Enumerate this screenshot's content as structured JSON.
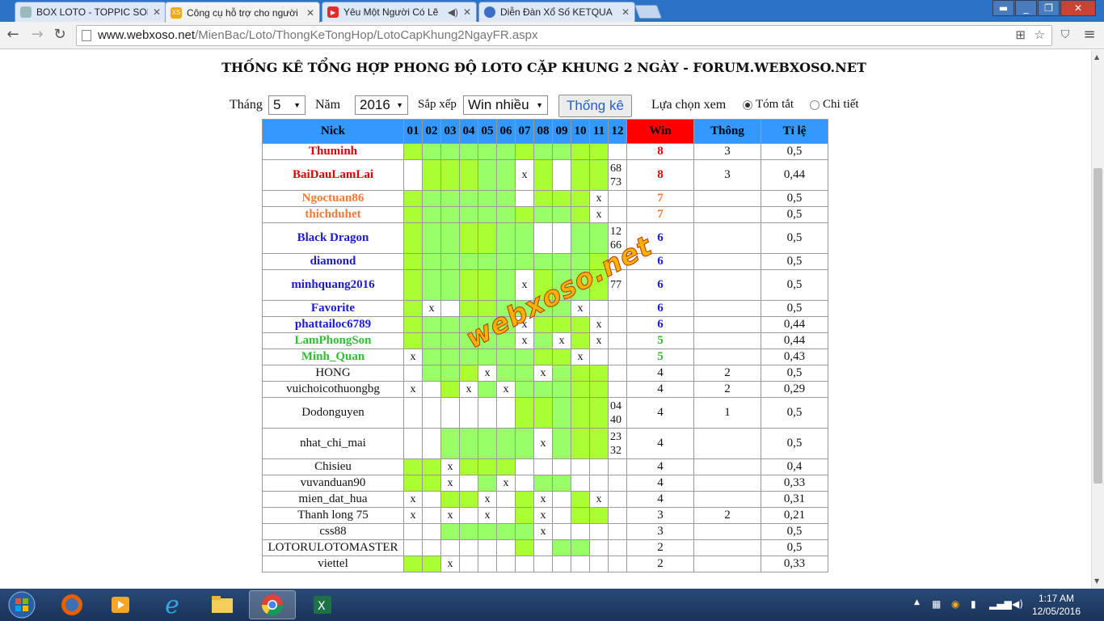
{
  "browser": {
    "tabs": [
      {
        "title": "BOX LOTO - TOPPIC SON",
        "icon": "tab-icon"
      },
      {
        "title": "Công cụ hỗ trợ cho người",
        "icon": "xs-icon"
      },
      {
        "title": "Yêu Một Người Có Lẽ",
        "icon": "youtube-icon"
      },
      {
        "title": "Diễn Đàn Xổ Số KETQUA",
        "icon": "forum-icon"
      }
    ],
    "url_host": "www.webxoso.net",
    "url_path": "/MienBac/Loto/ThongKeTongHop/LotoCapKhung2NgayFR.aspx"
  },
  "page": {
    "title": "THỐNG KÊ TỔNG HỢP PHONG ĐỘ LOTO CẶP KHUNG 2 NGÀY - FORUM.WEBXOSO.NET",
    "filters": {
      "month_label": "Tháng",
      "month_value": "5",
      "year_label": "Năm",
      "year_value": "2016",
      "sort_label": "Sắp xếp",
      "sort_value": "Win nhiều",
      "submit_label": "Thống kê",
      "view_label": "Lựa chọn xem",
      "opt_summary": "Tóm tắt",
      "opt_detail": "Chi tiết"
    },
    "watermark": "webxoso.net"
  },
  "table": {
    "headers": {
      "nick": "Nick",
      "win": "Win",
      "thong": "Thông",
      "ratio": "Tỉ lệ"
    },
    "days": [
      "01",
      "02",
      "03",
      "04",
      "05",
      "06",
      "07",
      "08",
      "09",
      "10",
      "11",
      "12"
    ],
    "rows": [
      {
        "nick": "Thuminh",
        "color": "#e00000",
        "bold": true,
        "tall": false,
        "cells": [
          "g1",
          "g2",
          "g2",
          "g2",
          "g2",
          "g2",
          "g1",
          "g2",
          "g2",
          "g1",
          "g1",
          ""
        ],
        "marks": [
          "",
          "",
          "",
          "",
          "",
          "",
          "",
          "",
          "",
          "",
          "",
          ""
        ],
        "extra": "",
        "win": "8",
        "thong": "3",
        "ratio": "0,5"
      },
      {
        "nick": "BaiDauLamLai",
        "color": "#e00000",
        "bold": true,
        "tall": true,
        "cells": [
          "",
          "g1",
          "g1",
          "g1",
          "g2",
          "g2",
          "",
          "g1",
          "",
          "g1",
          "g1",
          ""
        ],
        "marks": [
          "",
          "",
          "",
          "",
          "",
          "",
          "x",
          "",
          "",
          "",
          "",
          ""
        ],
        "extra": "68\n73",
        "win": "8",
        "thong": "3",
        "ratio": "0,44"
      },
      {
        "nick": "Ngoctuan86",
        "color": "#f07a3a",
        "bold": true,
        "tall": false,
        "cells": [
          "g1",
          "g2",
          "g2",
          "g2",
          "g2",
          "g2",
          "",
          "g1",
          "g1",
          "g1",
          "",
          ""
        ],
        "marks": [
          "",
          "",
          "",
          "",
          "",
          "",
          "",
          "",
          "",
          "",
          "x",
          ""
        ],
        "extra": "",
        "win": "7",
        "thong": "",
        "ratio": "0,5"
      },
      {
        "nick": "thichduhet",
        "color": "#f07a3a",
        "bold": true,
        "tall": false,
        "cells": [
          "g1",
          "g2",
          "g2",
          "g2",
          "g2",
          "g2",
          "g1",
          "g2",
          "g2",
          "g1",
          "",
          ""
        ],
        "marks": [
          "",
          "",
          "",
          "",
          "",
          "",
          "",
          "",
          "",
          "",
          "x",
          ""
        ],
        "extra": "",
        "win": "7",
        "thong": "",
        "ratio": "0,5"
      },
      {
        "nick": "Black Dragon",
        "color": "#1a1ad6",
        "bold": true,
        "tall": true,
        "cells": [
          "g1",
          "g2",
          "g2",
          "g1",
          "g1",
          "g2",
          "g2",
          "",
          "",
          "g2",
          "g2",
          ""
        ],
        "marks": [
          "",
          "",
          "",
          "",
          "",
          "",
          "",
          "",
          "",
          "",
          "",
          ""
        ],
        "extra": "12\n66",
        "win": "6",
        "thong": "",
        "ratio": "0,5"
      },
      {
        "nick": "diamond",
        "color": "#1a1ad6",
        "bold": true,
        "tall": false,
        "cells": [
          "g1",
          "g2",
          "g2",
          "g2",
          "g2",
          "g2",
          "g2",
          "g2",
          "g2",
          "g2",
          "g1",
          ""
        ],
        "marks": [
          "",
          "",
          "",
          "",
          "",
          "",
          "",
          "",
          "",
          "",
          "",
          ""
        ],
        "extra": "",
        "win": "6",
        "thong": "",
        "ratio": "0,5"
      },
      {
        "nick": "minhquang2016",
        "color": "#1a1ad6",
        "bold": true,
        "tall": true,
        "cells": [
          "g1",
          "g2",
          "g2",
          "g1",
          "g1",
          "g2",
          "",
          "g1",
          "g2",
          "g2",
          "g1",
          ""
        ],
        "marks": [
          "",
          "",
          "",
          "",
          "",
          "",
          "x",
          "",
          "",
          "",
          "",
          ""
        ],
        "extra": "77",
        "win": "6",
        "thong": "",
        "ratio": "0,5"
      },
      {
        "nick": "Favorite",
        "color": "#1a1ad6",
        "bold": true,
        "tall": false,
        "cells": [
          "g1",
          "",
          "",
          "g1",
          "g1",
          "g2",
          "g2",
          "g2",
          "g2",
          "",
          "",
          ""
        ],
        "marks": [
          "",
          "x",
          "",
          "",
          "",
          "",
          "",
          "",
          "",
          "x",
          "",
          ""
        ],
        "extra": "",
        "win": "6",
        "thong": "",
        "ratio": "0,5"
      },
      {
        "nick": "phattailoc6789",
        "color": "#1a1ad6",
        "bold": true,
        "tall": false,
        "cells": [
          "g1",
          "g2",
          "g2",
          "g2",
          "g2",
          "g2",
          "",
          "g1",
          "g1",
          "g1",
          "",
          ""
        ],
        "marks": [
          "",
          "",
          "",
          "",
          "",
          "",
          "x",
          "",
          "",
          "",
          "x",
          ""
        ],
        "extra": "",
        "win": "6",
        "thong": "",
        "ratio": "0,44"
      },
      {
        "nick": "LamPhongSon",
        "color": "#33bb33",
        "bold": true,
        "tall": false,
        "cells": [
          "g1",
          "g2",
          "g2",
          "g2",
          "g2",
          "g2",
          "",
          "g2",
          "",
          "g1",
          "",
          ""
        ],
        "marks": [
          "",
          "",
          "",
          "",
          "",
          "",
          "x",
          "",
          "x",
          "",
          "x",
          ""
        ],
        "extra": "",
        "win": "5",
        "thong": "",
        "ratio": "0,44"
      },
      {
        "nick": "Minh_Quan",
        "color": "#33bb33",
        "bold": true,
        "tall": false,
        "cells": [
          "",
          "g2",
          "g2",
          "g2",
          "g2",
          "g2",
          "g2",
          "g1",
          "g1",
          "",
          "",
          ""
        ],
        "marks": [
          "x",
          "",
          "",
          "",
          "",
          "",
          "",
          "",
          "",
          "x",
          "",
          ""
        ],
        "extra": "",
        "win": "5",
        "thong": "",
        "ratio": "0,43"
      },
      {
        "nick": "HONG",
        "color": "#111111",
        "bold": false,
        "tall": false,
        "cells": [
          "",
          "g2",
          "g2",
          "g1",
          "",
          "g2",
          "g2",
          "",
          "g2",
          "g1",
          "g1",
          ""
        ],
        "marks": [
          "",
          "",
          "",
          "",
          "x",
          "",
          "",
          "x",
          "",
          "",
          "",
          ""
        ],
        "extra": "",
        "win": "4",
        "thong": "2",
        "ratio": "0,5"
      },
      {
        "nick": "vuichoicothuongbg",
        "color": "#111111",
        "bold": false,
        "tall": false,
        "cells": [
          "",
          "",
          "g1",
          "",
          "g2",
          "",
          "g2",
          "g2",
          "g2",
          "g1",
          "g1",
          ""
        ],
        "marks": [
          "x",
          "",
          "",
          "x",
          "",
          "x",
          "",
          "",
          "",
          "",
          "",
          ""
        ],
        "extra": "",
        "win": "4",
        "thong": "2",
        "ratio": "0,29"
      },
      {
        "nick": "Dodonguyen",
        "color": "#111111",
        "bold": false,
        "tall": true,
        "cells": [
          "",
          "",
          "",
          "",
          "",
          "",
          "g1",
          "g1",
          "g2",
          "g1",
          "g1",
          ""
        ],
        "marks": [
          "",
          "",
          "",
          "",
          "",
          "",
          "",
          "",
          "",
          "",
          "",
          ""
        ],
        "extra": "04\n40",
        "win": "4",
        "thong": "1",
        "ratio": "0,5"
      },
      {
        "nick": "nhat_chi_mai",
        "color": "#111111",
        "bold": false,
        "tall": true,
        "cells": [
          "",
          "",
          "g2",
          "g2",
          "g2",
          "g2",
          "g2",
          "",
          "g2",
          "g1",
          "g1",
          ""
        ],
        "marks": [
          "",
          "",
          "",
          "",
          "",
          "",
          "",
          "x",
          "",
          "",
          "",
          ""
        ],
        "extra": "23\n32",
        "win": "4",
        "thong": "",
        "ratio": "0,5"
      },
      {
        "nick": "Chisieu",
        "color": "#111111",
        "bold": false,
        "tall": false,
        "cells": [
          "g1",
          "g1",
          "",
          "g1",
          "g1",
          "g1",
          "",
          "",
          "",
          "",
          "",
          ""
        ],
        "marks": [
          "",
          "",
          "x",
          "",
          "",
          "",
          "",
          "",
          "",
          "",
          "",
          ""
        ],
        "extra": "",
        "win": "4",
        "thong": "",
        "ratio": "0,4"
      },
      {
        "nick": "vuvanduan90",
        "color": "#111111",
        "bold": false,
        "tall": false,
        "cells": [
          "g1",
          "g1",
          "",
          "",
          "g2",
          "",
          "",
          "g2",
          "g2",
          "",
          "",
          ""
        ],
        "marks": [
          "",
          "",
          "x",
          "",
          "",
          "x",
          "",
          "",
          "",
          "",
          "",
          ""
        ],
        "extra": "",
        "win": "4",
        "thong": "",
        "ratio": "0,33"
      },
      {
        "nick": "mien_dat_hua",
        "color": "#111111",
        "bold": false,
        "tall": false,
        "cells": [
          "",
          "",
          "g1",
          "g1",
          "",
          "",
          "g1",
          "",
          "",
          "g1",
          "",
          ""
        ],
        "marks": [
          "x",
          "",
          "",
          "",
          "x",
          "",
          "",
          "x",
          "",
          "",
          "x",
          ""
        ],
        "extra": "",
        "win": "4",
        "thong": "",
        "ratio": "0,31"
      },
      {
        "nick": "Thanh long 75",
        "color": "#111111",
        "bold": false,
        "tall": false,
        "cells": [
          "",
          "",
          "",
          "",
          "",
          "",
          "g1",
          "",
          "",
          "g1",
          "g1",
          ""
        ],
        "marks": [
          "x",
          "",
          "x",
          "",
          "x",
          "",
          "",
          "x",
          "",
          "",
          "",
          ""
        ],
        "extra": "",
        "win": "3",
        "thong": "2",
        "ratio": "0,21"
      },
      {
        "nick": "css88",
        "color": "#111111",
        "bold": false,
        "tall": false,
        "cells": [
          "",
          "",
          "g2",
          "g2",
          "g2",
          "g2",
          "g2",
          "",
          "",
          "",
          "",
          ""
        ],
        "marks": [
          "",
          "",
          "",
          "",
          "",
          "",
          "",
          "x",
          "",
          "",
          "",
          ""
        ],
        "extra": "",
        "win": "3",
        "thong": "",
        "ratio": "0,5"
      },
      {
        "nick": "LOTORULOTOMASTER",
        "color": "#111111",
        "bold": false,
        "tall": false,
        "cells": [
          "",
          "",
          "",
          "",
          "",
          "",
          "g1",
          "",
          "g2",
          "g2",
          "",
          ""
        ],
        "marks": [
          "",
          "",
          "",
          "",
          "",
          "",
          "",
          "",
          "",
          "",
          "",
          ""
        ],
        "extra": "",
        "win": "2",
        "thong": "",
        "ratio": "0,5"
      },
      {
        "nick": "viettel",
        "color": "#111111",
        "bold": false,
        "tall": false,
        "cells": [
          "g1",
          "g1",
          "",
          "",
          "",
          "",
          "",
          "",
          "",
          "",
          "",
          ""
        ],
        "marks": [
          "",
          "",
          "x",
          "",
          "",
          "",
          "",
          "",
          "",
          "",
          "",
          ""
        ],
        "extra": "",
        "win": "2",
        "thong": "",
        "ratio": "0,33"
      }
    ]
  },
  "taskbar": {
    "time": "1:17 AM",
    "date": "12/05/2016"
  }
}
